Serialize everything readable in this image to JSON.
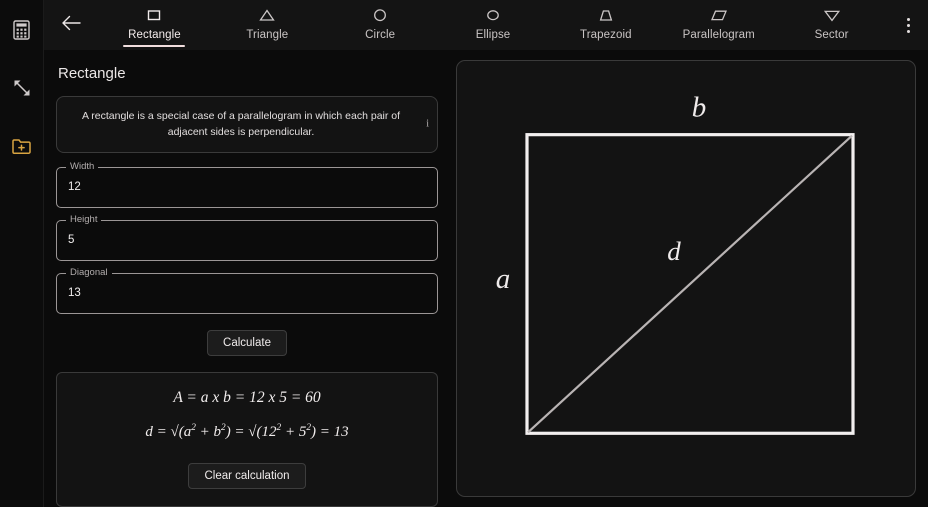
{
  "app": {
    "background": "#0b0b0b",
    "topbar_background": "#141414",
    "accent": "#f1dede",
    "folder_icon_color": "#d9a441"
  },
  "rail": {
    "items": [
      {
        "icon": "calculator-icon",
        "name": "calculator"
      },
      {
        "icon": "converter-arrows-icon",
        "name": "converter"
      },
      {
        "icon": "folder-add-icon",
        "name": "add-folder"
      }
    ]
  },
  "topbar": {
    "back_label": "back",
    "overflow_label": "more options",
    "tabs": [
      {
        "label": "Rectangle",
        "icon": "rectangle-icon",
        "active": true
      },
      {
        "label": "Triangle",
        "icon": "triangle-icon",
        "active": false
      },
      {
        "label": "Circle",
        "icon": "circle-icon",
        "active": false
      },
      {
        "label": "Ellipse",
        "icon": "ellipse-icon",
        "active": false
      },
      {
        "label": "Trapezoid",
        "icon": "trapezoid-icon",
        "active": false
      },
      {
        "label": "Parallelogram",
        "icon": "parallelogram-icon",
        "active": false
      },
      {
        "label": "Sector",
        "icon": "sector-icon",
        "active": false
      }
    ]
  },
  "main": {
    "title": "Rectangle",
    "description": "A rectangle is a special case of a parallelogram in which each pair of adjacent sides is perpendicular.",
    "info_icon": "i",
    "fields": [
      {
        "label": "Width",
        "value": "12"
      },
      {
        "label": "Height",
        "value": "5"
      },
      {
        "label": "Diagonal",
        "value": "13"
      }
    ],
    "calculate_label": "Calculate",
    "clear_label": "Clear calculation",
    "results": {
      "area_formula": "A = a x b = 12 x 5 = 60",
      "diagonal_formula_prefix": "d = √(a",
      "diagonal_parts": {
        "p1": "d = √(a",
        "s1": "2",
        "p2": " + b",
        "s2": "2",
        "p3": ") = √(12",
        "s3": "2",
        "p4": " + 5",
        "s4": "2",
        "p5": ") = 13"
      }
    }
  },
  "diagram": {
    "top_label": "b",
    "left_label": "a",
    "diagonal_label": "d",
    "shape": "rectangle-with-diagonal"
  }
}
